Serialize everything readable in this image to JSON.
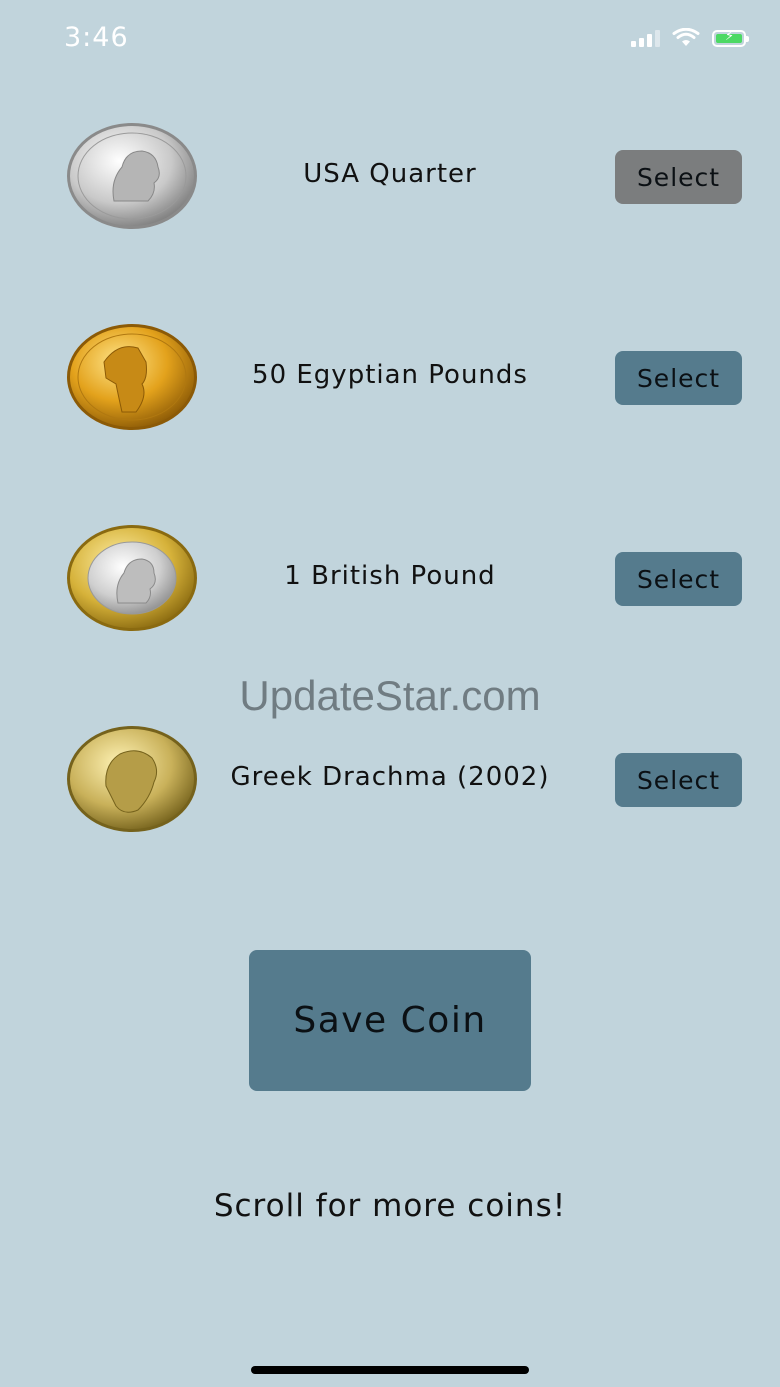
{
  "status_bar": {
    "time": "3:46",
    "icons": [
      "cellular-signal-icon",
      "wifi-icon",
      "battery-charging-icon"
    ],
    "battery_color": "#4cd964"
  },
  "coins": [
    {
      "name": "USA Quarter",
      "button_label": "Select",
      "selected": true,
      "icon": "usa-quarter-coin-icon"
    },
    {
      "name": "50 Egyptian Pounds",
      "button_label": "Select",
      "selected": false,
      "icon": "egyptian-pound-coin-icon"
    },
    {
      "name": "1 British Pound",
      "button_label": "Select",
      "selected": false,
      "icon": "british-pound-coin-icon"
    },
    {
      "name": "Greek Drachma (2002)",
      "button_label": "Select",
      "selected": false,
      "icon": "greek-drachma-coin-icon"
    }
  ],
  "watermark": "UpdateStar.com",
  "save_button_label": "Save Coin",
  "scroll_hint": "Scroll for more coins!",
  "colors": {
    "background": "#c1d4dc",
    "button": "#557b8d",
    "button_selected": "#7b7d7e"
  }
}
